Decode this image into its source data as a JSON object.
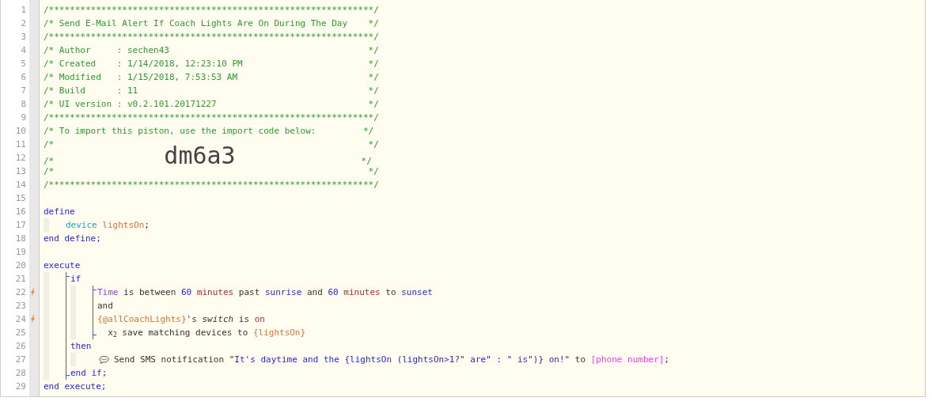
{
  "code": [
    {
      "number": "1",
      "flag": false,
      "tokens": [
        {
          "kind": "comment",
          "text": "/**************************************************************/"
        }
      ]
    },
    {
      "number": "2",
      "flag": false,
      "tokens": [
        {
          "kind": "comment",
          "text": "/* Send E-Mail Alert If Coach Lights Are On During The Day    */"
        }
      ]
    },
    {
      "number": "3",
      "flag": false,
      "tokens": [
        {
          "kind": "comment",
          "text": "/**************************************************************/"
        }
      ]
    },
    {
      "number": "4",
      "flag": false,
      "tokens": [
        {
          "kind": "comment",
          "text": "/* Author     : sechen43                                      */"
        }
      ]
    },
    {
      "number": "5",
      "flag": false,
      "tokens": [
        {
          "kind": "comment",
          "text": "/* Created    : 1/14/2018, 12:23:10 PM                        */"
        }
      ]
    },
    {
      "number": "6",
      "flag": false,
      "tokens": [
        {
          "kind": "comment",
          "text": "/* Modified   : 1/15/2018, 7:53:53 AM                         */"
        }
      ]
    },
    {
      "number": "7",
      "flag": false,
      "tokens": [
        {
          "kind": "comment",
          "text": "/* Build      : 11                                            */"
        }
      ]
    },
    {
      "number": "8",
      "flag": false,
      "tokens": [
        {
          "kind": "comment",
          "text": "/* UI version : v0.2.101.20171227                             */"
        }
      ]
    },
    {
      "number": "9",
      "flag": false,
      "tokens": [
        {
          "kind": "comment",
          "text": "/**************************************************************/"
        }
      ]
    },
    {
      "number": "10",
      "flag": false,
      "tokens": [
        {
          "kind": "comment",
          "text": "/* To import this piston, use the import code below:         */"
        }
      ]
    },
    {
      "number": "11",
      "flag": false,
      "tokens": [
        {
          "kind": "comment",
          "text": "/*                                                            */"
        }
      ]
    },
    {
      "number": "12",
      "flag": false,
      "tokens": [
        {
          "kind": "comment",
          "text": "/*                     "
        },
        {
          "kind": "big",
          "text": "dm6a3"
        },
        {
          "kind": "comment",
          "text": "                        */"
        }
      ]
    },
    {
      "number": "13",
      "flag": false,
      "tokens": [
        {
          "kind": "comment",
          "text": "/*                                                            */"
        }
      ]
    },
    {
      "number": "14",
      "flag": false,
      "tokens": [
        {
          "kind": "comment",
          "text": "/**************************************************************/"
        }
      ]
    },
    {
      "number": "15",
      "flag": false
    },
    {
      "number": "16",
      "flag": false,
      "tokens": [
        {
          "kind": "keyword",
          "text": "define"
        }
      ]
    },
    {
      "kind": "indent",
      "lines": [
        {
          "number": "17",
          "flag": false,
          "tokens": [
            {
              "kind": "type",
              "text": "device "
            },
            {
              "kind": "var",
              "text": "lightsOn"
            },
            {
              "kind": "plain",
              "text": ";"
            }
          ]
        }
      ]
    },
    {
      "number": "18",
      "flag": false,
      "tokens": [
        {
          "kind": "keyword",
          "text": "end define;"
        }
      ]
    },
    {
      "number": "19",
      "flag": false
    },
    {
      "number": "20",
      "flag": false,
      "tokens": [
        {
          "kind": "keyword",
          "text": "execute"
        }
      ]
    },
    {
      "kind": "indent",
      "lines": [
        {
          "kind": "bracket",
          "lines": [
            {
              "number": "21",
              "flag": false,
              "tokens": [
                {
                  "kind": "keyword",
                  "text": "if"
                }
              ]
            },
            {
              "kind": "indent",
              "lines": [
                {
                  "kind": "bracket",
                  "lines": [
                    {
                      "number": "22",
                      "flag": true,
                      "tokens": [
                        {
                          "kind": "attr",
                          "text": "Time"
                        },
                        {
                          "kind": "plain",
                          "text": " is between "
                        },
                        {
                          "kind": "keyword",
                          "text": "60 "
                        },
                        {
                          "kind": "unit",
                          "text": "minutes"
                        },
                        {
                          "kind": "plain",
                          "text": " past "
                        },
                        {
                          "kind": "keyword",
                          "text": "sunrise"
                        },
                        {
                          "kind": "plain",
                          "text": " and "
                        },
                        {
                          "kind": "keyword",
                          "text": "60 "
                        },
                        {
                          "kind": "unit",
                          "text": "minutes"
                        },
                        {
                          "kind": "plain",
                          "text": " to "
                        },
                        {
                          "kind": "keyword",
                          "text": "sunset"
                        }
                      ]
                    },
                    {
                      "number": "23",
                      "flag": false,
                      "tokens": [
                        {
                          "kind": "plain",
                          "text": "and"
                        }
                      ]
                    },
                    {
                      "number": "24",
                      "flag": true,
                      "tokens": [
                        {
                          "kind": "var",
                          "text": "{@allCoachLights}"
                        },
                        {
                          "kind": "plain",
                          "text": "'s "
                        },
                        {
                          "kind": "italic",
                          "text": "switch"
                        },
                        {
                          "kind": "plain",
                          "text": " is "
                        },
                        {
                          "kind": "unit",
                          "text": "on"
                        }
                      ]
                    },
                    {
                      "number": "25",
                      "flag": false,
                      "tokens": [
                        {
                          "kind": "plain",
                          "text": "  x$_{2}$ save matching devices to "
                        },
                        {
                          "kind": "var",
                          "text": "{lightsOn}"
                        }
                      ]
                    }
                  ]
                }
              ]
            },
            {
              "number": "26",
              "flag": false,
              "tokens": [
                {
                  "kind": "keyword",
                  "text": "then"
                }
              ]
            },
            {
              "kind": "indent",
              "lines": [
                {
                  "number": "27",
                  "flag": false,
                  "kind": "action",
                  "tokens": [
                    {
                      "kind": "plain",
                      "text": "Send SMS notification \""
                    },
                    {
                      "kind": "keyword",
                      "text": "It's daytime and the {lightsOn (lightsOn>1?\" are\" : \" is\")} on!"
                    },
                    {
                      "kind": "plain",
                      "text": "\" to "
                    },
                    {
                      "kind": "device",
                      "text": "[phone number]"
                    },
                    {
                      "kind": "plain",
                      "text": ";"
                    }
                  ]
                }
              ]
            },
            {
              "number": "28",
              "flag": false,
              "tokens": [
                {
                  "kind": "keyword",
                  "text": "end if;"
                }
              ]
            }
          ]
        }
      ]
    },
    {
      "number": "29",
      "flag": false,
      "tokens": [
        {
          "kind": "keyword",
          "text": "end execute;"
        }
      ]
    }
  ]
}
